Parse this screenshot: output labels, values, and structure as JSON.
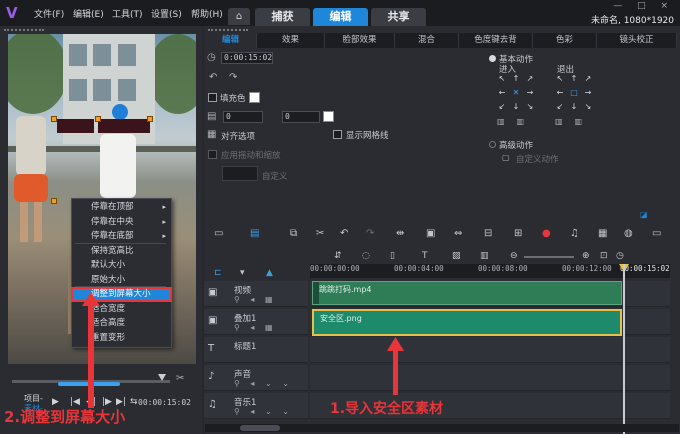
{
  "app": {
    "logo_glyph": "V",
    "menus": [
      "文件(F)",
      "编辑(E)",
      "工具(T)",
      "设置(S)",
      "帮助(H)"
    ],
    "home_glyph": "⌂",
    "primary_tabs": [
      "捕获",
      "编辑",
      "共享"
    ],
    "active_tab": "编辑",
    "project_info": "未命名, 1080*1920",
    "window_controls": "— □ ×"
  },
  "context_menu": {
    "items": [
      {
        "label": "停靠在顶部",
        "submenu": true
      },
      {
        "label": "停靠在中央",
        "submenu": true
      },
      {
        "label": "停靠在底部",
        "submenu": true
      },
      {
        "label": "保持宽高比",
        "submenu": false
      },
      {
        "label": "默认大小",
        "submenu": false
      },
      {
        "label": "原始大小",
        "submenu": false
      },
      {
        "label": "调整到屏幕大小",
        "submenu": false,
        "highlighted": true
      },
      {
        "label": "适合宽度",
        "submenu": false
      },
      {
        "label": "适合高度",
        "submenu": false
      },
      {
        "label": "重置变形",
        "submenu": false
      }
    ],
    "submenu_glyph": "▸"
  },
  "playback": {
    "project_label": "项目-",
    "material_label": "素材-",
    "timecode": "00:00:15:02",
    "controls": [
      "▶",
      "|◀",
      "◀|",
      "|▶",
      "▶|",
      "⇆",
      "🔊",
      "⌐"
    ]
  },
  "annotations": {
    "step2": "2.调整到屏幕大小",
    "step1": "1.导入安全区素材",
    "color": "#e8353a"
  },
  "options": {
    "tabs": [
      "编辑",
      "效果",
      "脸部效果",
      "混合",
      "色度键去背",
      "色彩",
      "镜头校正"
    ],
    "active_tab": "编辑",
    "duration": "0:00:15:02",
    "fill_color_label": "填充色",
    "spin1": "0",
    "spin2": "0",
    "align_options_label": "对齐选项",
    "show_grid_label": "显示网格线",
    "apply_shake_label": "应用摇动和缩放",
    "custom_label": "自定义",
    "basic_motion_label": "基本动作",
    "enter_label": "进入",
    "exit_label": "退出",
    "advanced_motion_label": "高级动作",
    "custom_motion_label": "自定义动作"
  },
  "timeline": {
    "ruler": [
      "00:00:00:00",
      "00:00:04:00",
      "00:00:08:00",
      "00:00:12:00",
      "00:00:15:02"
    ],
    "tracks": [
      {
        "name": "视频",
        "icon": "▣"
      },
      {
        "name": "叠加1",
        "icon": "▣"
      },
      {
        "name": "标题1",
        "icon": "T"
      },
      {
        "name": "声音",
        "icon": "♪"
      },
      {
        "name": "音乐1",
        "icon": "♫"
      }
    ],
    "video_clip": "跳跳打码.mp4",
    "overlay_clip": "安全区.png"
  }
}
